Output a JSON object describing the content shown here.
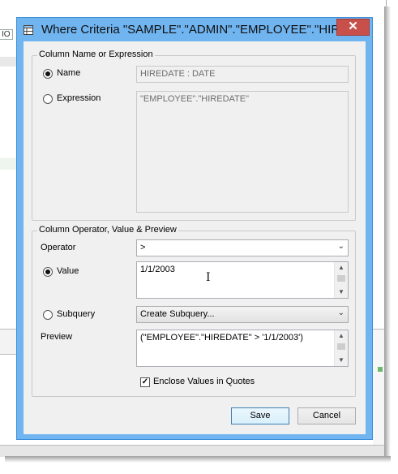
{
  "background_app": {
    "corner_text": "IO"
  },
  "dialog": {
    "title": "Where Criteria \"SAMPLE\".\"ADMIN\".\"EMPLOYEE\".\"HIRE...",
    "close_glyph": "✕",
    "column_group": {
      "legend": "Column Name or Expression",
      "name_label": "Name",
      "name_value": "HIREDATE : DATE",
      "name_selected": true,
      "expression_label": "Expression",
      "expression_value": "\"EMPLOYEE\".\"HIREDATE\"",
      "expression_selected": false
    },
    "operator_group": {
      "legend": "Column Operator, Value & Preview",
      "operator_label": "Operator",
      "operator_value": ">",
      "value_label": "Value",
      "value_text": "1/1/2003",
      "value_selected": true,
      "subquery_label": "Subquery",
      "subquery_value": "Create Subquery...",
      "subquery_selected": false,
      "preview_label": "Preview",
      "preview_text": "(\"EMPLOYEE\".\"HIREDATE\" > '1/1/2003')",
      "enclose_label": "Enclose Values in Quotes",
      "enclose_checked": true
    },
    "buttons": {
      "save": "Save",
      "cancel": "Cancel"
    }
  },
  "colors": {
    "title_bar": "#70b4f0",
    "close_button": "#c7504b",
    "dialog_body": "#f0f0f0"
  },
  "icons": {
    "window_icon": "table-window-icon",
    "close": "close-icon",
    "dropdown": "chevron-down-icon",
    "scroll_up": "scroll-up-icon",
    "scroll_down": "scroll-down-icon",
    "text_cursor": "ibeam-cursor-icon"
  }
}
